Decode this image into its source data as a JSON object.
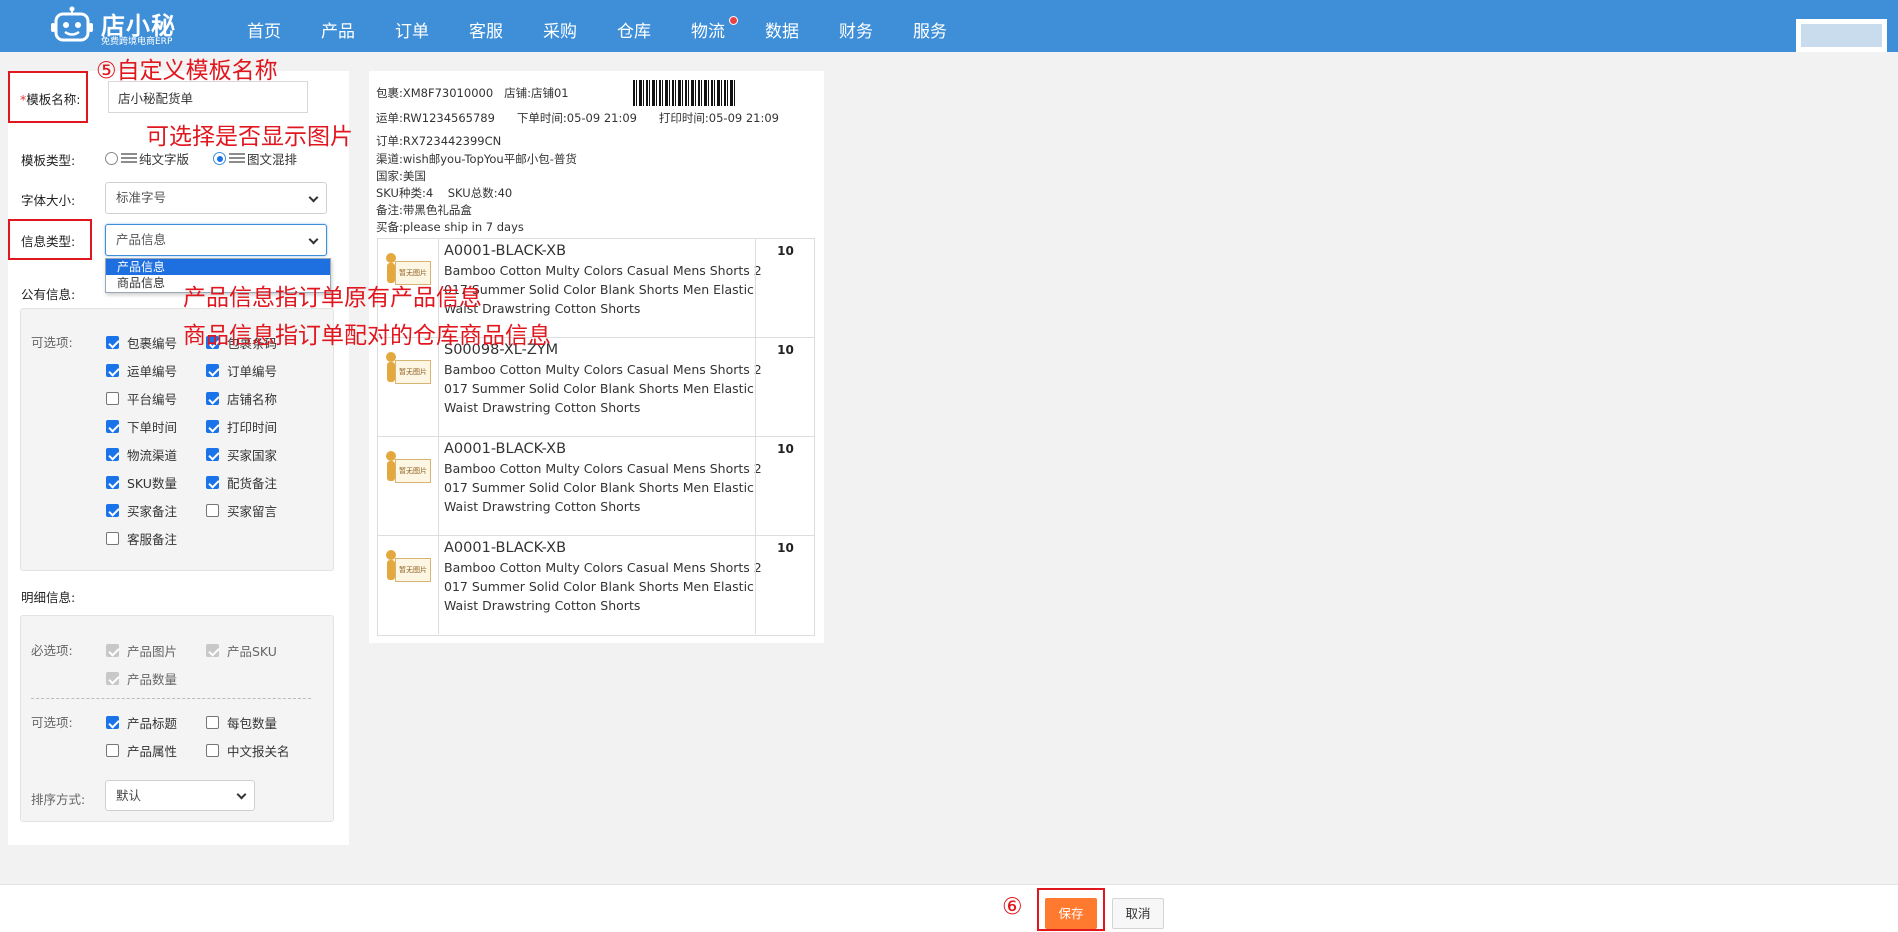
{
  "logo": {
    "title": "店小秘",
    "subtitle": "免费跨境电商ERP"
  },
  "nav": {
    "items": [
      "首页",
      "产品",
      "订单",
      "客服",
      "采购",
      "仓库",
      "物流",
      "数据",
      "财务",
      "服务"
    ]
  },
  "form": {
    "template_name": {
      "label": "模板名称:",
      "value": "店小秘配货单"
    },
    "template_type": {
      "label": "模板类型:",
      "options": [
        "纯文字版",
        "图文混排"
      ],
      "selected": "图文混排"
    },
    "font_size": {
      "label": "字体大小:",
      "value": "标准字号"
    },
    "info_type": {
      "label": "信息类型:",
      "value": "产品信息",
      "dropdown": [
        "产品信息",
        "商品信息"
      ]
    },
    "public_info": {
      "label": "公有信息:",
      "optional_label": "可选项:",
      "items": [
        {
          "label": "包裹编号",
          "checked": true
        },
        {
          "label": "包裹条码",
          "checked": true
        },
        {
          "label": "运单编号",
          "checked": true
        },
        {
          "label": "订单编号",
          "checked": true
        },
        {
          "label": "平台编号",
          "checked": false
        },
        {
          "label": "店铺名称",
          "checked": true
        },
        {
          "label": "下单时间",
          "checked": true
        },
        {
          "label": "打印时间",
          "checked": true
        },
        {
          "label": "物流渠道",
          "checked": true
        },
        {
          "label": "买家国家",
          "checked": true
        },
        {
          "label": "SKU数量",
          "checked": true
        },
        {
          "label": "配货备注",
          "checked": true
        },
        {
          "label": "买家备注",
          "checked": true
        },
        {
          "label": "买家留言",
          "checked": false
        },
        {
          "label": "客服备注",
          "checked": false
        }
      ]
    },
    "detail_info": {
      "label": "明细信息:",
      "required_label": "必选项:",
      "required": [
        "产品图片",
        "产品SKU",
        "产品数量"
      ],
      "optional_label": "可选项:",
      "optional": [
        {
          "label": "产品标题",
          "checked": true
        },
        {
          "label": "每包数量",
          "checked": false
        },
        {
          "label": "产品属性",
          "checked": false
        },
        {
          "label": "中文报关名",
          "checked": false
        }
      ],
      "sort_label": "排序方式:",
      "sort_value": "默认"
    }
  },
  "preview": {
    "package": "包裹:XM8F73010000",
    "shop": "店铺:店铺01",
    "waybill": "运单:RW1234565789",
    "order_time": "下单时间:05-09 21:09",
    "print_time": "打印时间:05-09 21:09",
    "order": "订单:RX723442399CN",
    "channel": "渠道:wish邮you-TopYou平邮小包-普货",
    "country": "国家:美国",
    "sku_stats": "SKU种类:4    SKU总数:40",
    "remark": "备注:带黑色礼品盒",
    "buyer_note": "买备:please ship in 7 days",
    "placeholder_label": "暂无图片",
    "items": [
      {
        "sku": "A0001-BLACK-XB",
        "title": "Bamboo Cotton Multy Colors Casual Mens Shorts 2017 Summer Solid Color Blank Shorts Men Elastic Waist Drawstring Cotton Shorts",
        "qty": "10"
      },
      {
        "sku": "S00098-XL-ZYM",
        "title": "Bamboo Cotton Multy Colors Casual Mens Shorts 2017 Summer Solid Color Blank Shorts Men Elastic Waist Drawstring Cotton Shorts",
        "qty": "10"
      },
      {
        "sku": "A0001-BLACK-XB",
        "title": "Bamboo Cotton Multy Colors Casual Mens Shorts 2017 Summer Solid Color Blank Shorts Men Elastic Waist Drawstring Cotton Shorts",
        "qty": "10"
      },
      {
        "sku": "A0001-BLACK-XB",
        "title": "Bamboo Cotton Multy Colors Casual Mens Shorts 2017 Summer Solid Color Blank Shorts Men Elastic Waist Drawstring Cotton Shorts",
        "qty": "10"
      }
    ]
  },
  "annotations": {
    "step5": "⑤自定义模板名称",
    "image_hint": "可选择是否显示图片",
    "info_hint_1": "产品信息指订单原有产品信息",
    "info_hint_2": "商品信息指订单配对的仓库商品信息",
    "step6": "⑥"
  },
  "footer": {
    "save": "保存",
    "cancel": "取消"
  },
  "colors": {
    "nav_bg": "#3f8fd8",
    "accent": "#1a73e8",
    "save_btn": "#ff7a2f",
    "annotation": "#e0171f"
  }
}
